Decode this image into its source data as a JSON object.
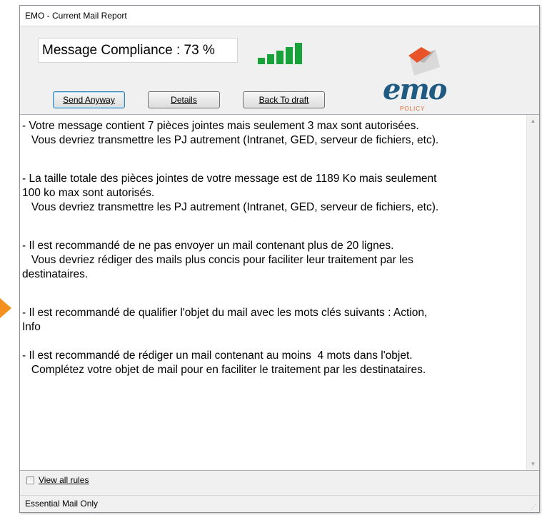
{
  "window": {
    "title": "EMO - Current Mail Report"
  },
  "header": {
    "compliance_label": "Message Compliance : 73 %",
    "compliance_percent": 73,
    "signal_bars_filled": 5,
    "signal_color": "#17a33a",
    "buttons": {
      "send_anyway": "Send Anyway",
      "details": "Details",
      "back_to_draft": "Back To draft"
    },
    "logo": {
      "word": "emo",
      "tagline": "POLICY",
      "brand_color": "#1e5a82",
      "accent_color": "#e5642c"
    }
  },
  "messages": [
    [
      "- Votre message contient 7 pièces jointes mais seulement 3 max sont autorisées.",
      "   Vous devriez transmettre les PJ autrement (Intranet, GED, serveur de fichiers, etc)."
    ],
    [
      "- La taille totale des pièces jointes de votre message est de 1189 Ko mais seulement",
      "100 ko max sont autorisés.",
      "   Vous devriez transmettre les PJ autrement (Intranet, GED, serveur de fichiers, etc)."
    ],
    [
      "- Il est recommandé de ne pas envoyer un mail contenant plus de 20 lignes.",
      "   Vous devriez rédiger des mails plus concis pour faciliter leur traitement par les",
      "destinataires."
    ],
    [
      "- Il est recommandé de qualifier l'objet du mail avec les mots clés suivants : Action,",
      "Info"
    ],
    [
      "- Il est recommandé de rédiger un mail contenant au moins  4 mots dans l'objet.",
      "   Complétez votre objet de mail pour en faciliter le traitement par les destinataires."
    ]
  ],
  "footer": {
    "view_all_rules_label": "View all rules",
    "view_all_rules_checked": false,
    "status_text": "Essential Mail Only"
  },
  "icons": {
    "scroll_up": "scroll-up-arrow-icon",
    "scroll_down": "scroll-down-arrow-icon",
    "signal": "signal-strength-icon",
    "arrow": "orange-pointer-arrow-icon"
  }
}
